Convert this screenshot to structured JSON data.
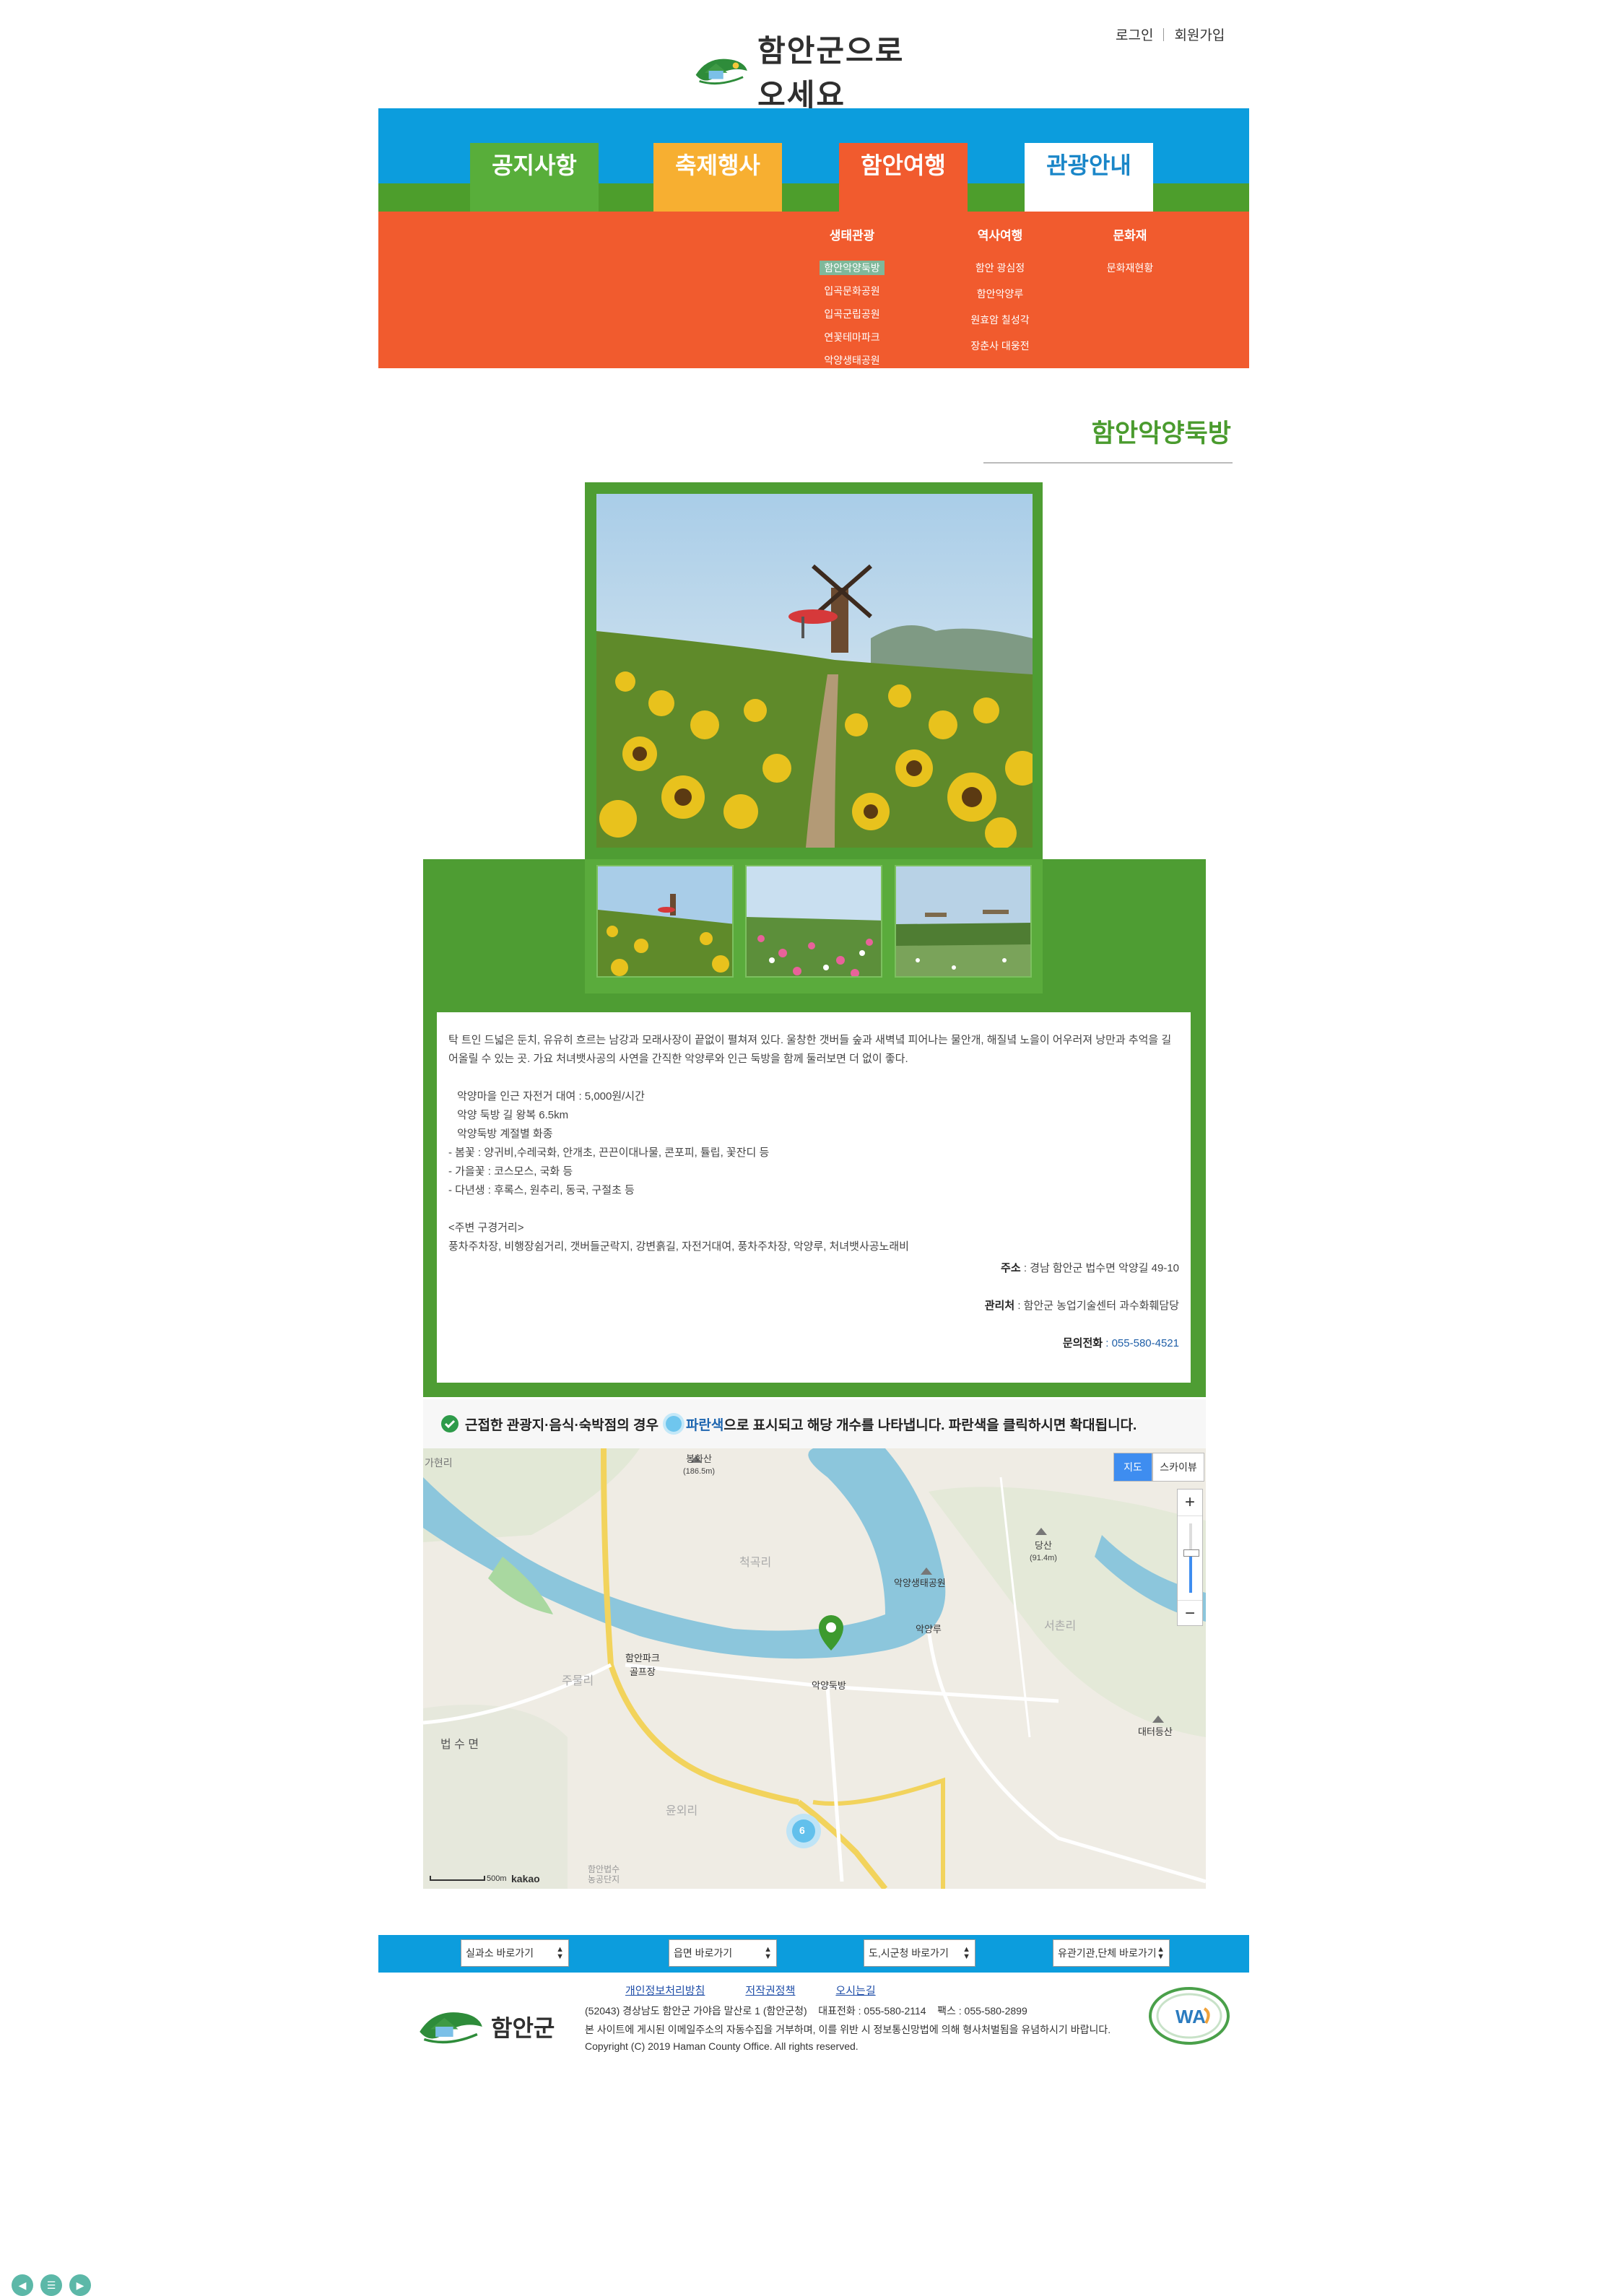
{
  "header": {
    "login": "로그인",
    "signup": "회원가입",
    "logo_text": "함안군으로 오세요"
  },
  "nav": {
    "tabs": [
      "공지사항",
      "축제행사",
      "함안여행",
      "관광안내"
    ],
    "sub": {
      "col1_title": "생태관광",
      "col1_items": [
        "함안악양둑방",
        "입곡문화공원",
        "입곡군립공원",
        "연꽃테마파크",
        "악양생태공원"
      ],
      "col2_title": "역사여행",
      "col2_items": [
        "함안 광심정",
        "함안악양루",
        "원효암 칠성각",
        "장춘사 대웅전"
      ],
      "col3_title": "문화재",
      "col3_items": [
        "문화재현황"
      ]
    }
  },
  "page": {
    "title": "함안악양둑방"
  },
  "description": {
    "intro": "탁 트인 드넓은 둔치, 유유히 흐르는 남강과 모래사장이 끝없이 펼쳐져 있다. 울창한 갯버들 숲과 새벽녘 피어나는 물안개, 해질녘 노을이 어우러져 낭만과 추억을 길어올릴 수 있는 곳. 가요 처녀뱃사공의 사연을 간직한 악양루와 인근 둑방을 함께 둘러보면 더 없이 좋다.",
    "lines": [
      "악양마을 인근 자전거 대여 : 5,000원/시간",
      "악양 둑방 길 왕복 6.5km",
      "악양둑방 계절별 화종",
      "- 봄꽃 : 양귀비,수레국화, 안개초, 끈끈이대나물, 콘포피, 튤립, 꽃잔디 등",
      "- 가을꽃 : 코스모스, 국화 등",
      "- 다년생 : 후록스, 원추리, 동국, 구절초 등"
    ],
    "nearby_title": "<주변 구경거리>",
    "nearby": "풍차주차장, 비행장쉼거리, 갯버들군락지, 강변흙길, 자전거대여, 풍차주차장, 악양루, 처녀뱃사공노래비",
    "address_label": "주소",
    "address": " : 경남 함안군 법수면 악양길 49-10",
    "manager_label": "관리처",
    "manager": " : 함안군 농업기술센터 과수화훼담당",
    "phone_label": "문의전화",
    "phone": " : 055-580-4521"
  },
  "map": {
    "note_pre": "근접한 관광지·음식·숙박점의 경우",
    "note_blue": "파란색",
    "note_post": "으로 표시되고 해당 개수를 나타냅니다. 파란색을 클릭하시면 확대됩니다.",
    "btn_map": "지도",
    "btn_sky": "스카이뷰",
    "zoom_in": "+",
    "zoom_out": "−",
    "labels": {
      "ga": "가현리",
      "bonghwa": "봉화산",
      "bonghwa_h": "(186.5m)",
      "cheok": "척곡리",
      "dang": "당산",
      "dang_h": "(91.4m)",
      "akyang_park": "악양생태공원",
      "akyangru": "악양루",
      "seochon": "서촌리",
      "jupo": "주물리",
      "golf": "함안파크",
      "golf2": "골프장",
      "dukbang": "악양둑방",
      "beopsu": "법 수 면",
      "daeteo": "대터등산",
      "yunoe": "윤외리",
      "nongong": "함안법수",
      "nongong2": "농공단지",
      "scale": "500m",
      "kakao": "kakao",
      "cluster": "6"
    }
  },
  "footer": {
    "selects": [
      "실과소 바로가기",
      "읍면 바로가기",
      "도,시군청 바로가기",
      "유관기관,단체 바로가기"
    ],
    "links": [
      "개인정보처리방침",
      "저작권정책",
      "오시는길"
    ],
    "address": "(52043) 경상남도 함안군 가야읍 말산로 1 (함안군청)    대표전화 : 055-580-2114    팩스 : 055-580-2899",
    "notice": "본 사이트에 게시된 이메일주소의 자동수집을 거부하며, 이를 위반 시 정보통신망법에 의해 형사처벌됨을 유념하시기 바랍니다.",
    "copyright": "Copyright (C) 2019 Haman County Office. All rights reserved.",
    "logo_text": "함안군",
    "wa_mark": "WA"
  },
  "colors": {
    "blue": "#0c9ddd",
    "green": "#4e9d33",
    "orange": "#f15b2e",
    "yellow": "#f7af31"
  }
}
